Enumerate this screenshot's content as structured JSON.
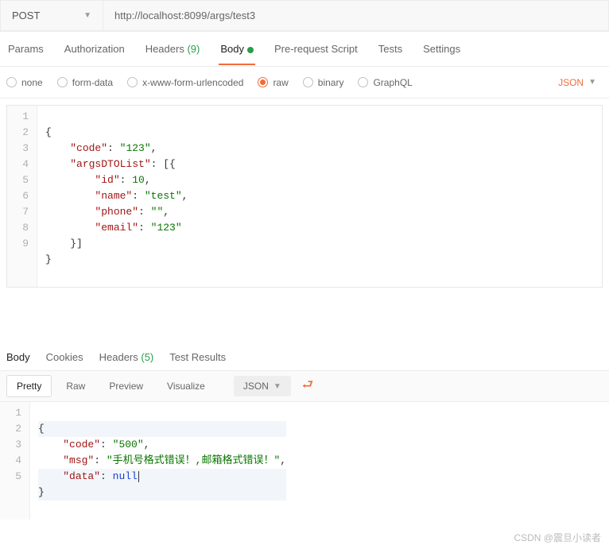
{
  "http": {
    "method": "POST",
    "url": "http://localhost:8099/args/test3"
  },
  "tabs": {
    "params": "Params",
    "auth": "Authorization",
    "headers": "Headers",
    "headers_count": "(9)",
    "body": "Body",
    "prerequest": "Pre-request Script",
    "tests": "Tests",
    "settings": "Settings"
  },
  "body_types": {
    "none": "none",
    "form_data": "form-data",
    "urlencoded": "x-www-form-urlencoded",
    "raw": "raw",
    "binary": "binary",
    "graphql": "GraphQL"
  },
  "body_format_label": "JSON",
  "request_body": {
    "lines": [
      "1",
      "2",
      "3",
      "4",
      "5",
      "6",
      "7",
      "8",
      "9"
    ],
    "l1": "{",
    "l2_k": "\"code\"",
    "l2_v": "\"123\"",
    "l3_k": "\"argsDTOList\"",
    "l4_k": "\"id\"",
    "l4_v": "10",
    "l5_k": "\"name\"",
    "l5_v": "\"test\"",
    "l6_k": "\"phone\"",
    "l6_v": "\"\"",
    "l7_k": "\"email\"",
    "l7_v": "\"123\"",
    "l9": "}"
  },
  "resp_tabs": {
    "body": "Body",
    "cookies": "Cookies",
    "headers": "Headers",
    "headers_count": "(5)",
    "tests": "Test Results"
  },
  "resp_views": {
    "pretty": "Pretty",
    "raw": "Raw",
    "preview": "Preview",
    "visualize": "Visualize",
    "format": "JSON"
  },
  "response_body": {
    "lines": [
      "1",
      "2",
      "3",
      "4",
      "5"
    ],
    "l1": "{",
    "l2_k": "\"code\"",
    "l2_v": "\"500\"",
    "l3_k": "\"msg\"",
    "l3_v": "\"手机号格式错误！,邮箱格式错误！\"",
    "l4_k": "\"data\"",
    "l4_v": "null",
    "l5": "}"
  },
  "watermark": "CSDN @震旦小读者"
}
